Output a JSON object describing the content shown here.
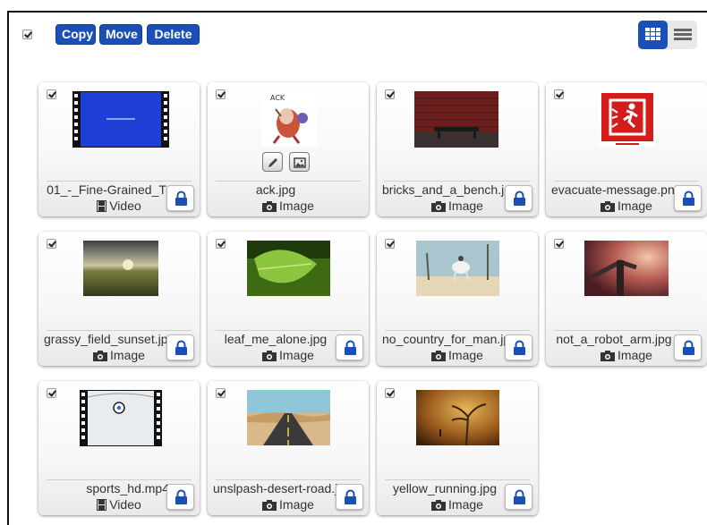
{
  "toolbar": {
    "copy_label": "Copy",
    "move_label": "Move",
    "delete_label": "Delete"
  },
  "accent_color": "#1a4fb8",
  "items": [
    {
      "name": "01_-_Fine-Grained_T",
      "type": "Video",
      "icon": "film-icon"
    },
    {
      "name": "ack.jpg",
      "type": "Image",
      "icon": "camera-icon"
    },
    {
      "name": "bricks_and_a_bench.jpg",
      "type": "Image",
      "icon": "camera-icon"
    },
    {
      "name": "evacuate-message.png",
      "type": "Image",
      "icon": "camera-icon"
    },
    {
      "name": "grassy_field_sunset.jpg",
      "type": "Image",
      "icon": "camera-icon"
    },
    {
      "name": "leaf_me_alone.jpg",
      "type": "Image",
      "icon": "camera-icon"
    },
    {
      "name": "no_country_for_man.jpg",
      "type": "Image",
      "icon": "camera-icon"
    },
    {
      "name": "not_a_robot_arm.jpg",
      "type": "Image",
      "icon": "camera-icon"
    },
    {
      "name": "sports_hd.mp4",
      "type": "Video",
      "icon": "film-icon"
    },
    {
      "name": "unslpash-desert-road.jpg",
      "type": "Image",
      "icon": "camera-icon"
    },
    {
      "name": "yellow_running.jpg",
      "type": "Image",
      "icon": "camera-icon"
    }
  ]
}
